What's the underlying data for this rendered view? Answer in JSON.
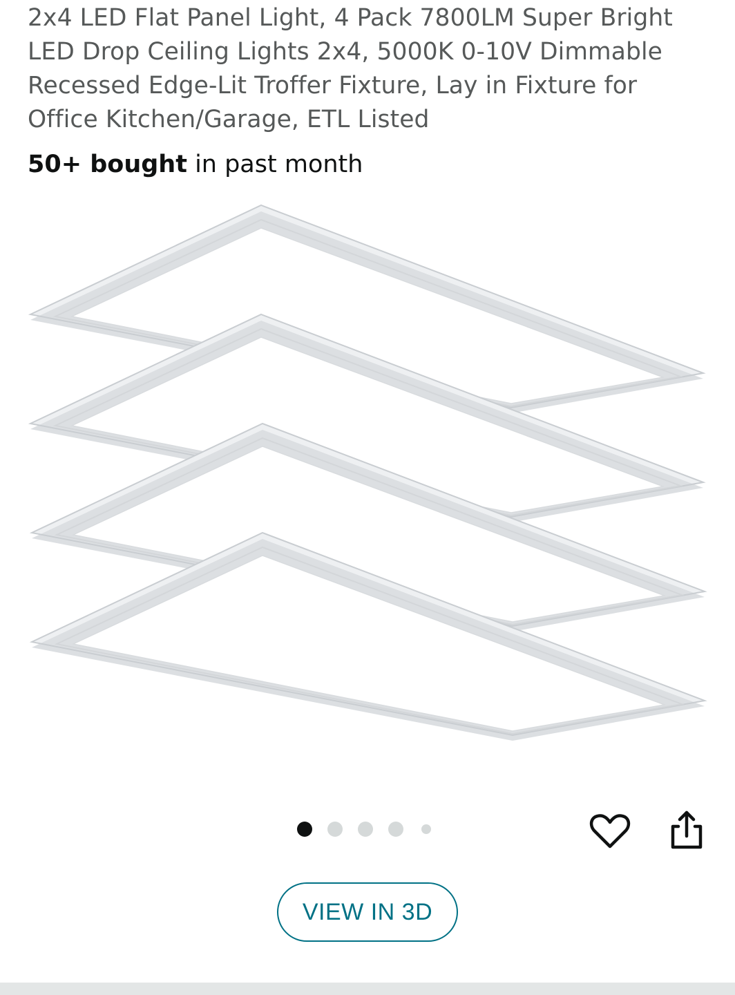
{
  "product": {
    "title": "2x4 LED Flat Panel Light, 4 Pack 7800LM Super Bright LED Drop Ceiling Lights 2x4, 5000K 0-10V Dimmable Recessed Edge-Lit Troffer Fixture, Lay in Fixture for Office Kitchen/Garage, ETL Listed",
    "bought_count": "50+ bought",
    "bought_suffix": " in past month"
  },
  "gallery": {
    "image_count": 5,
    "active_index": 0,
    "panels_shown": 4
  },
  "actions": {
    "wishlist_icon": "heart-outline-icon",
    "share_icon": "share-icon",
    "view_3d_label": "VIEW IN 3D"
  },
  "colors": {
    "link": "#007185",
    "title_text": "#565959",
    "body_text": "#0f1111"
  }
}
